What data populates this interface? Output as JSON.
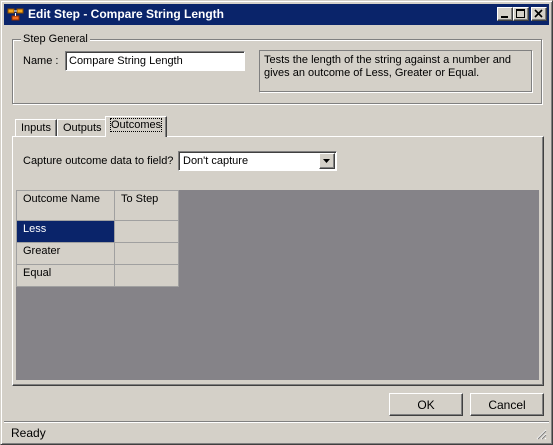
{
  "window": {
    "title": "Edit Step - Compare String Length",
    "app_icon": "app-icon",
    "controls": [
      "minimize",
      "maximize",
      "close"
    ]
  },
  "step_general": {
    "legend": "Step General",
    "name_label": "Name :",
    "name_value": "Compare String Length",
    "description": "Tests the length of the string against a number and gives an outcome of Less, Greater or Equal."
  },
  "tabs": [
    {
      "label": "Inputs"
    },
    {
      "label": "Outputs"
    },
    {
      "label": "Outcomes",
      "active": true
    }
  ],
  "outcomes": {
    "capture_label": "Capture outcome data to field?",
    "capture_value": "Don't capture",
    "columns": [
      "Outcome Name",
      "To Step"
    ],
    "rows": [
      {
        "name": "Less",
        "to_step": "",
        "selected": true
      },
      {
        "name": "Greater",
        "to_step": ""
      },
      {
        "name": "Equal",
        "to_step": ""
      }
    ]
  },
  "buttons": {
    "ok": "OK",
    "cancel": "Cancel"
  },
  "status": {
    "text": "Ready"
  },
  "colors": {
    "titlebar": "#0a246a",
    "face": "#d4d0c8",
    "grid_background": "#858388",
    "selection": "#0a246a"
  }
}
